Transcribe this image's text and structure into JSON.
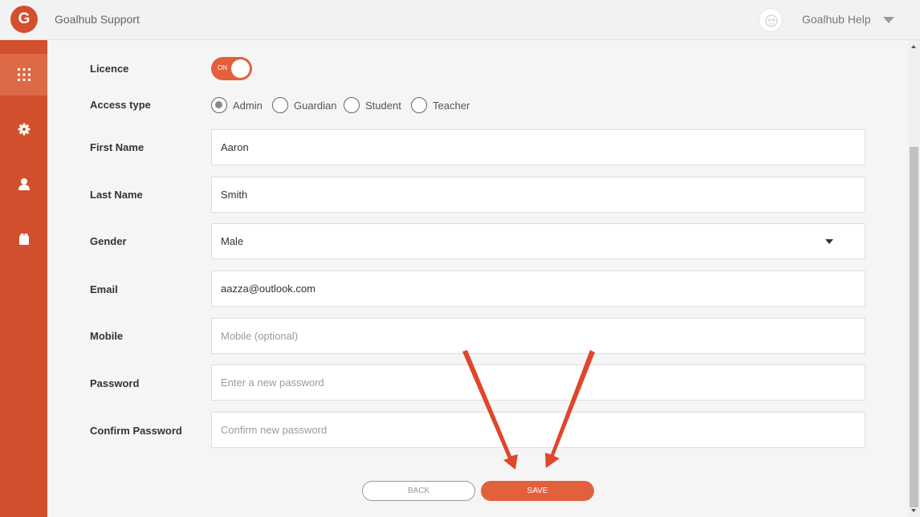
{
  "header": {
    "logo_letter": "G",
    "app_title": "Goalhub Support",
    "account_name": "Goalhub Help"
  },
  "sidebar": {
    "items": [
      {
        "icon": "apps-grid-icon",
        "active": true
      },
      {
        "icon": "gear-icon",
        "active": false
      },
      {
        "icon": "user-icon",
        "active": false
      },
      {
        "icon": "puzzle-icon",
        "active": false
      }
    ]
  },
  "form": {
    "licence": {
      "label": "Licence",
      "toggle_text": "ON",
      "state": "on"
    },
    "access_type": {
      "label": "Access type",
      "options": [
        "Admin",
        "Guardian",
        "Student",
        "Teacher"
      ],
      "selected": "Admin"
    },
    "first_name": {
      "label": "First Name",
      "value": "Aaron"
    },
    "last_name": {
      "label": "Last Name",
      "value": "Smith"
    },
    "gender": {
      "label": "Gender",
      "value": "Male"
    },
    "email": {
      "label": "Email",
      "value": "aazza@outlook.com"
    },
    "mobile": {
      "label": "Mobile",
      "placeholder": "Mobile (optional)"
    },
    "password": {
      "label": "Password",
      "placeholder": "Enter a new password"
    },
    "confirm_password": {
      "label": "Confirm Password",
      "placeholder": "Confirm new password"
    }
  },
  "buttons": {
    "back": "BACK",
    "save": "SAVE"
  },
  "colors": {
    "brand": "#d2502d",
    "accent": "#e2603c",
    "sidebar_active": "#dc6a47",
    "annotation_arrow": "#e0462a"
  }
}
